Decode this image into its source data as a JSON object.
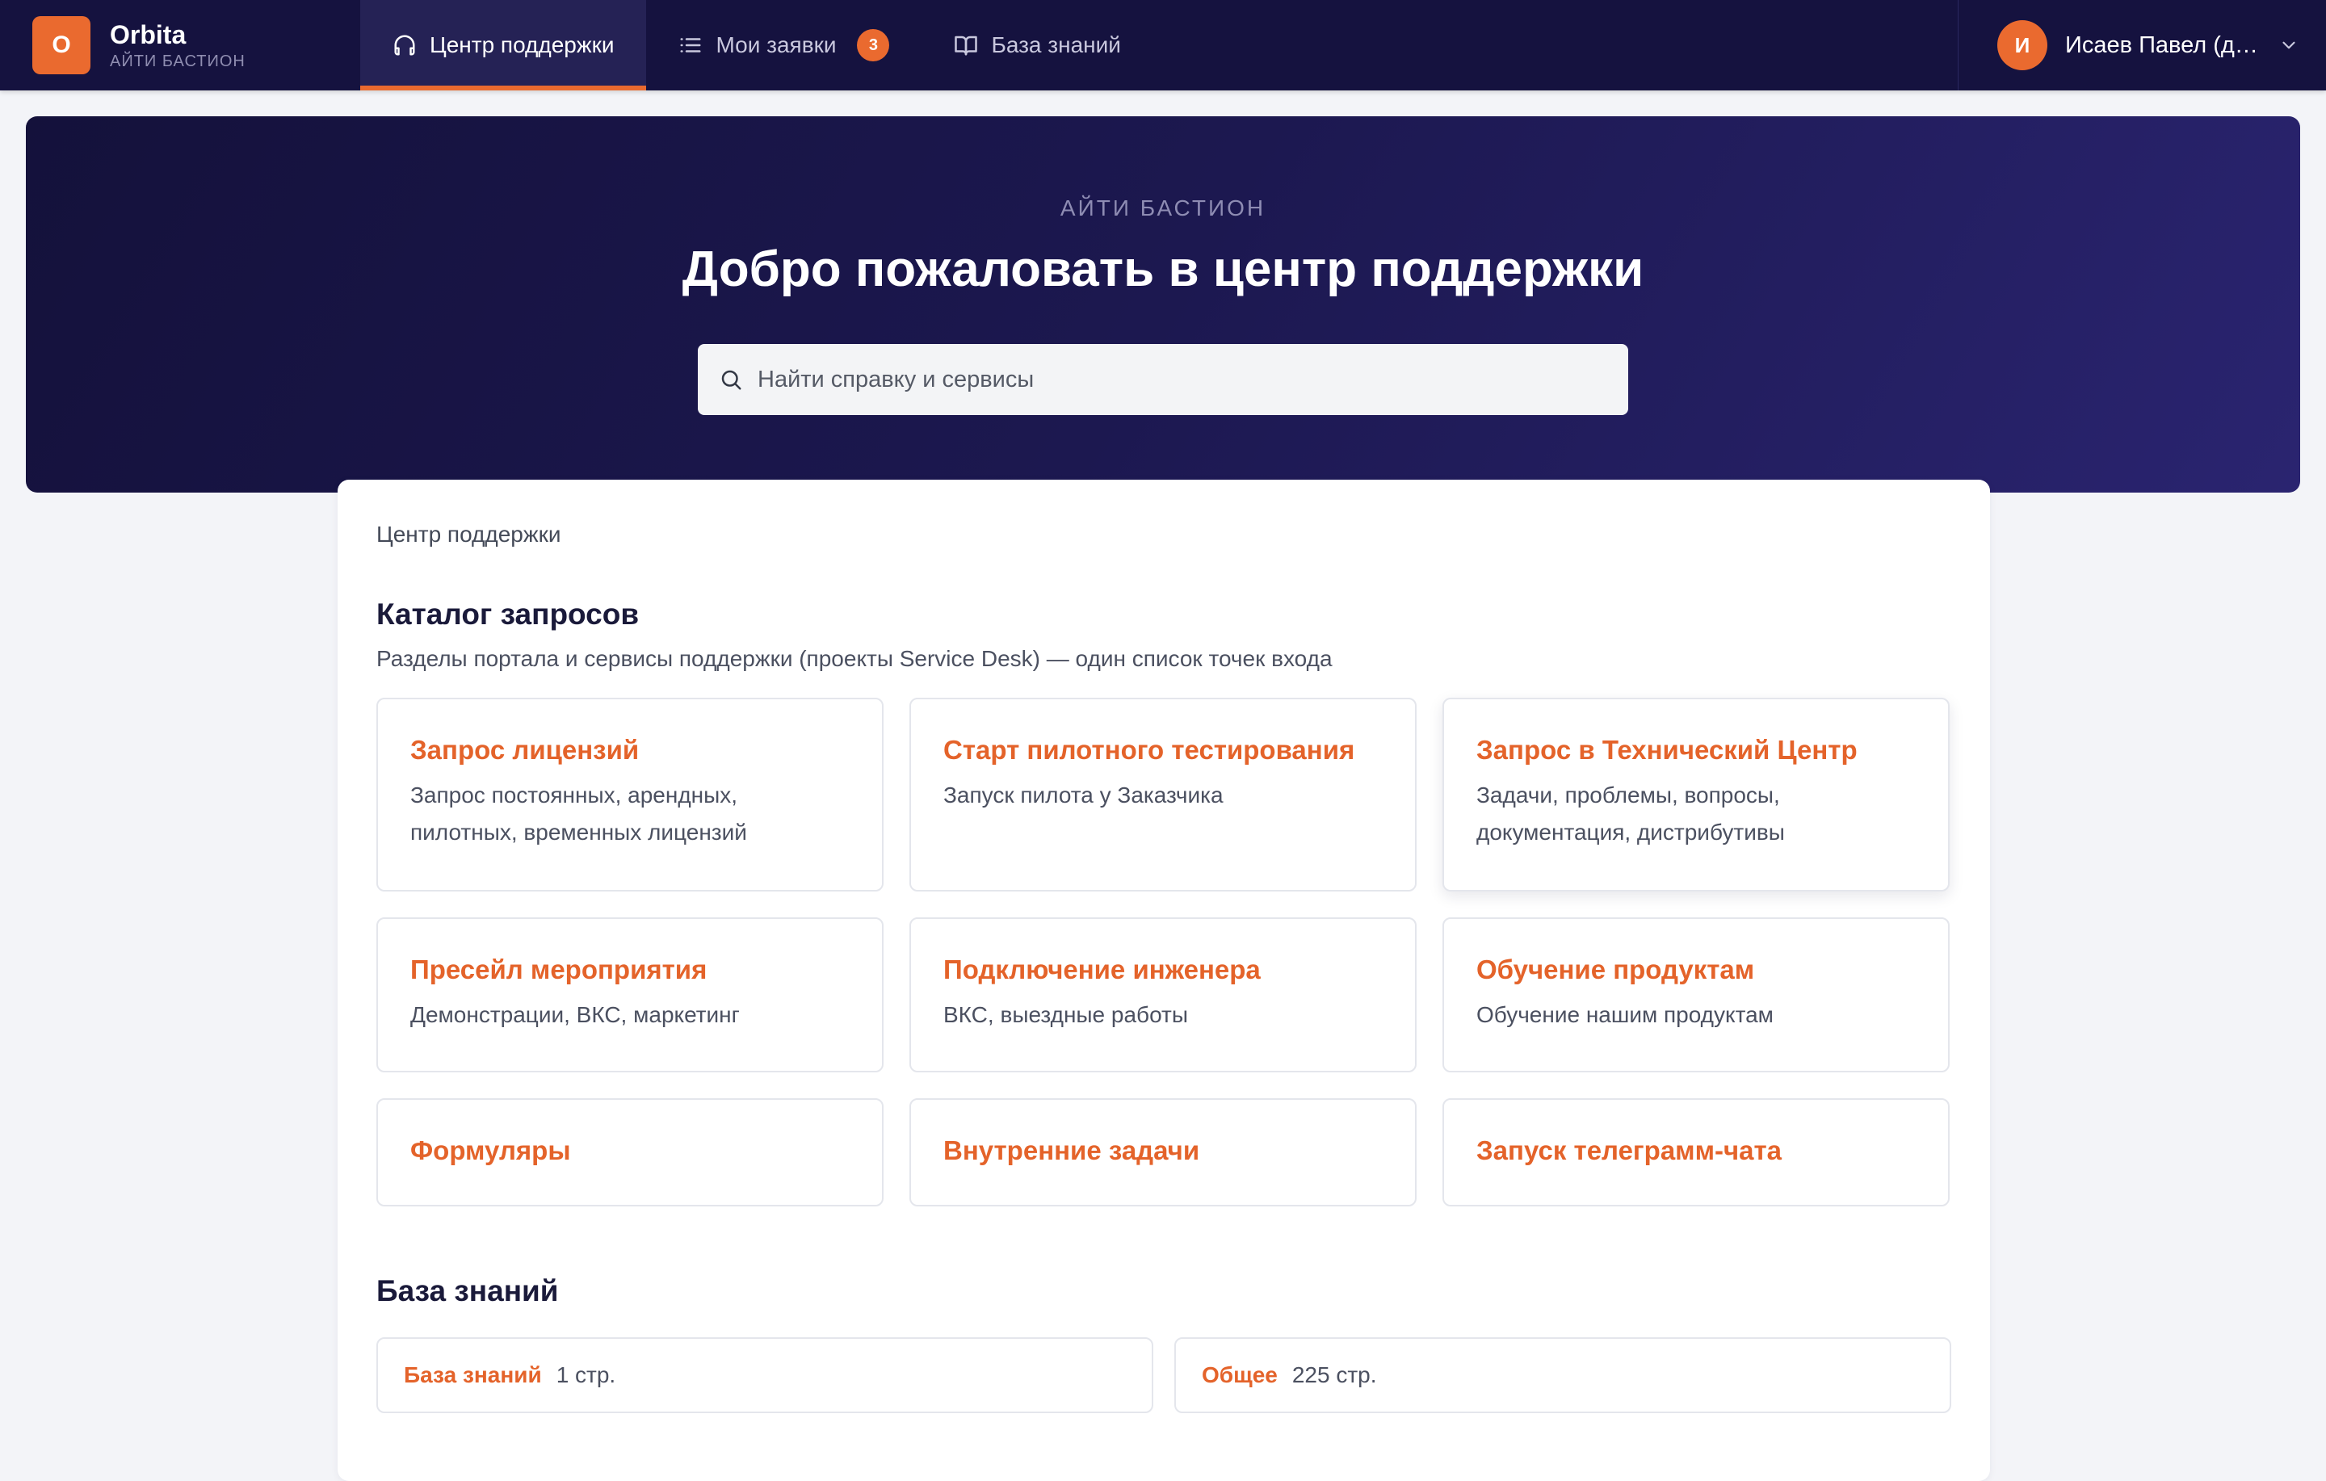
{
  "brand": {
    "logo_letter": "O",
    "name": "Orbita",
    "subtitle": "АЙТИ БАСТИОН"
  },
  "nav": {
    "tabs": [
      {
        "label": "Центр поддержки",
        "icon": "headset-icon",
        "active": true
      },
      {
        "label": "Мои заявки",
        "icon": "list-icon",
        "badge": "3"
      },
      {
        "label": "База знаний",
        "icon": "book-icon"
      }
    ]
  },
  "user": {
    "initial": "И",
    "name": "Исаев Павел (демо)"
  },
  "hero": {
    "kicker": "АЙТИ БАСТИОН",
    "title": "Добро пожаловать в центр поддержки",
    "search_placeholder": "Найти справку и сервисы"
  },
  "main": {
    "breadcrumb": "Центр поддержки",
    "catalog": {
      "title": "Каталог запросов",
      "subtitle": "Разделы портала и сервисы поддержки (проекты Service Desk) — один список точек входа",
      "cards": [
        {
          "title": "Запрос лицензий",
          "desc": "Запрос постоянных, арендных, пилотных, временных лицензий"
        },
        {
          "title": "Старт пилотного тестирования",
          "desc": "Запуск пилота у Заказчика"
        },
        {
          "title": "Запрос в Технический Центр",
          "desc": "Задачи, проблемы, вопросы, документация, дистрибутивы"
        },
        {
          "title": "Пресейл мероприятия",
          "desc": "Демонстрации, ВКС, маркетинг"
        },
        {
          "title": "Подключение инженера",
          "desc": "ВКС, выездные работы"
        },
        {
          "title": "Обучение продуктам",
          "desc": "Обучение нашим продуктам"
        },
        {
          "title": "Формуляры",
          "desc": ""
        },
        {
          "title": "Внутренние задачи",
          "desc": ""
        },
        {
          "title": "Запуск телеграмм-чата",
          "desc": ""
        }
      ]
    },
    "knowledge_base": {
      "title": "База знаний",
      "spaces": [
        {
          "name": "База знаний",
          "count": "1 стр."
        },
        {
          "name": "Общее",
          "count": "225 стр."
        }
      ]
    }
  },
  "colors": {
    "accent": "#ea6a2f",
    "nav_bg": "#15123f",
    "hero_start": "#14113b",
    "hero_end": "#2a2470"
  }
}
